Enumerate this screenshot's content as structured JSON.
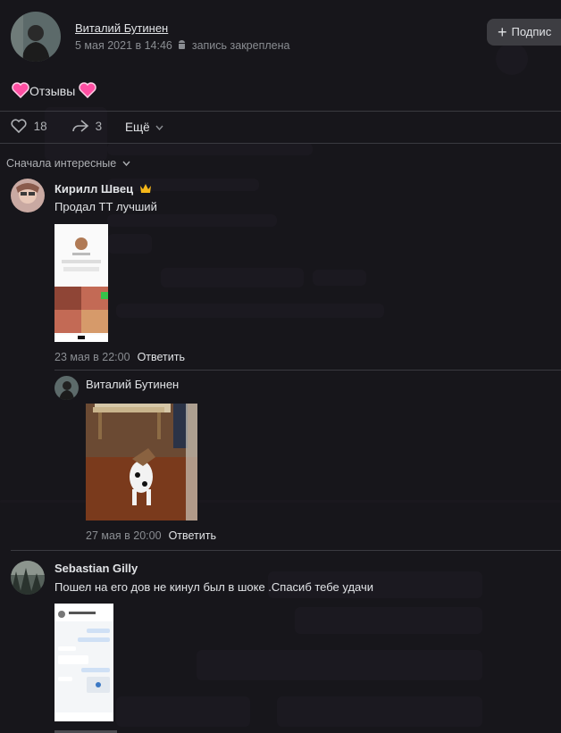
{
  "post": {
    "author": "Виталий Бутинен",
    "date": "5 мая 2021 в 14:46",
    "pinned": "запись закреплена",
    "subscribe_label": "Подпис",
    "text": "Отзывы",
    "likes": "18",
    "shares": "3",
    "more_label": "Ещё"
  },
  "sort_label": "Сначала интересные",
  "comments": [
    {
      "author": "Кирилл Швец",
      "text": "Продал ТТ лучший",
      "date": "23 мая в 22:00",
      "reply": "Ответить"
    },
    {
      "author": "Виталий Бутинен",
      "date": "27 мая в 20:00",
      "reply": "Ответить"
    },
    {
      "author": "Sebastian Gilly",
      "text": "Пошел на его дов не кинул был в шоке .Спасиб тебе удачи"
    }
  ],
  "colors": {
    "background": "#17161b",
    "text": "#e1e3e6",
    "muted": "#8a8d92",
    "heart": "#ff4fa3"
  }
}
